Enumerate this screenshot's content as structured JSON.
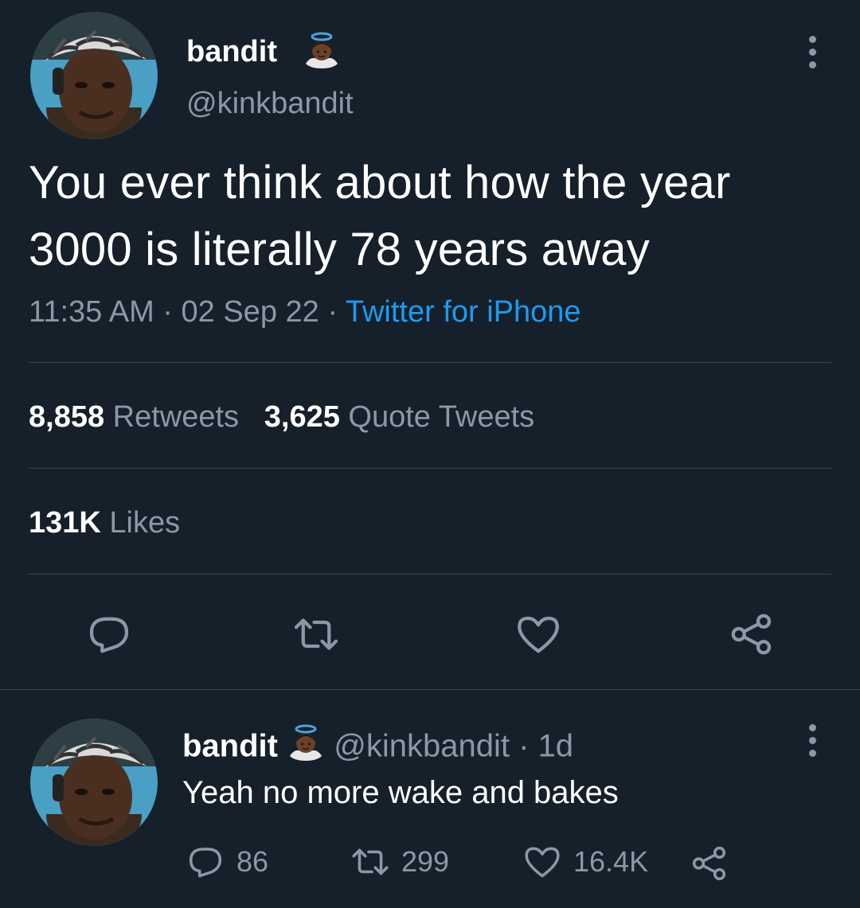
{
  "tweet": {
    "display_name": "bandit",
    "handle": "@kinkbandit",
    "text_line1": "You ever think about how the year",
    "text_line2": "3000 is literally 78 years away",
    "time": "11:35 AM",
    "sep1": " · ",
    "date": "02 Sep 22",
    "sep2": " · ",
    "source": "Twitter for iPhone",
    "retweets_count": "8,858",
    "retweets_label": "Retweets",
    "quotes_count": "3,625",
    "quotes_label": "Quote Tweets",
    "likes_count": "131K",
    "likes_label": "Likes",
    "name_emoji": "angel-emoji"
  },
  "reply": {
    "display_name": "bandit",
    "handle": "@kinkbandit",
    "dot": "·",
    "time": "1d",
    "text": "Yeah no more wake and bakes",
    "replies": "86",
    "retweets": "299",
    "likes": "16.4K",
    "name_emoji": "angel-emoji"
  },
  "icons": {
    "reply": "reply-bubble-icon",
    "retweet": "retweet-icon",
    "like": "heart-icon",
    "share": "share-icon",
    "more": "more-vertical-icon"
  },
  "colors": {
    "background": "#15202b",
    "text": "#ffffff",
    "secondary": "#8b98a5",
    "link": "#1d9bf0",
    "divider": "#38444d"
  }
}
